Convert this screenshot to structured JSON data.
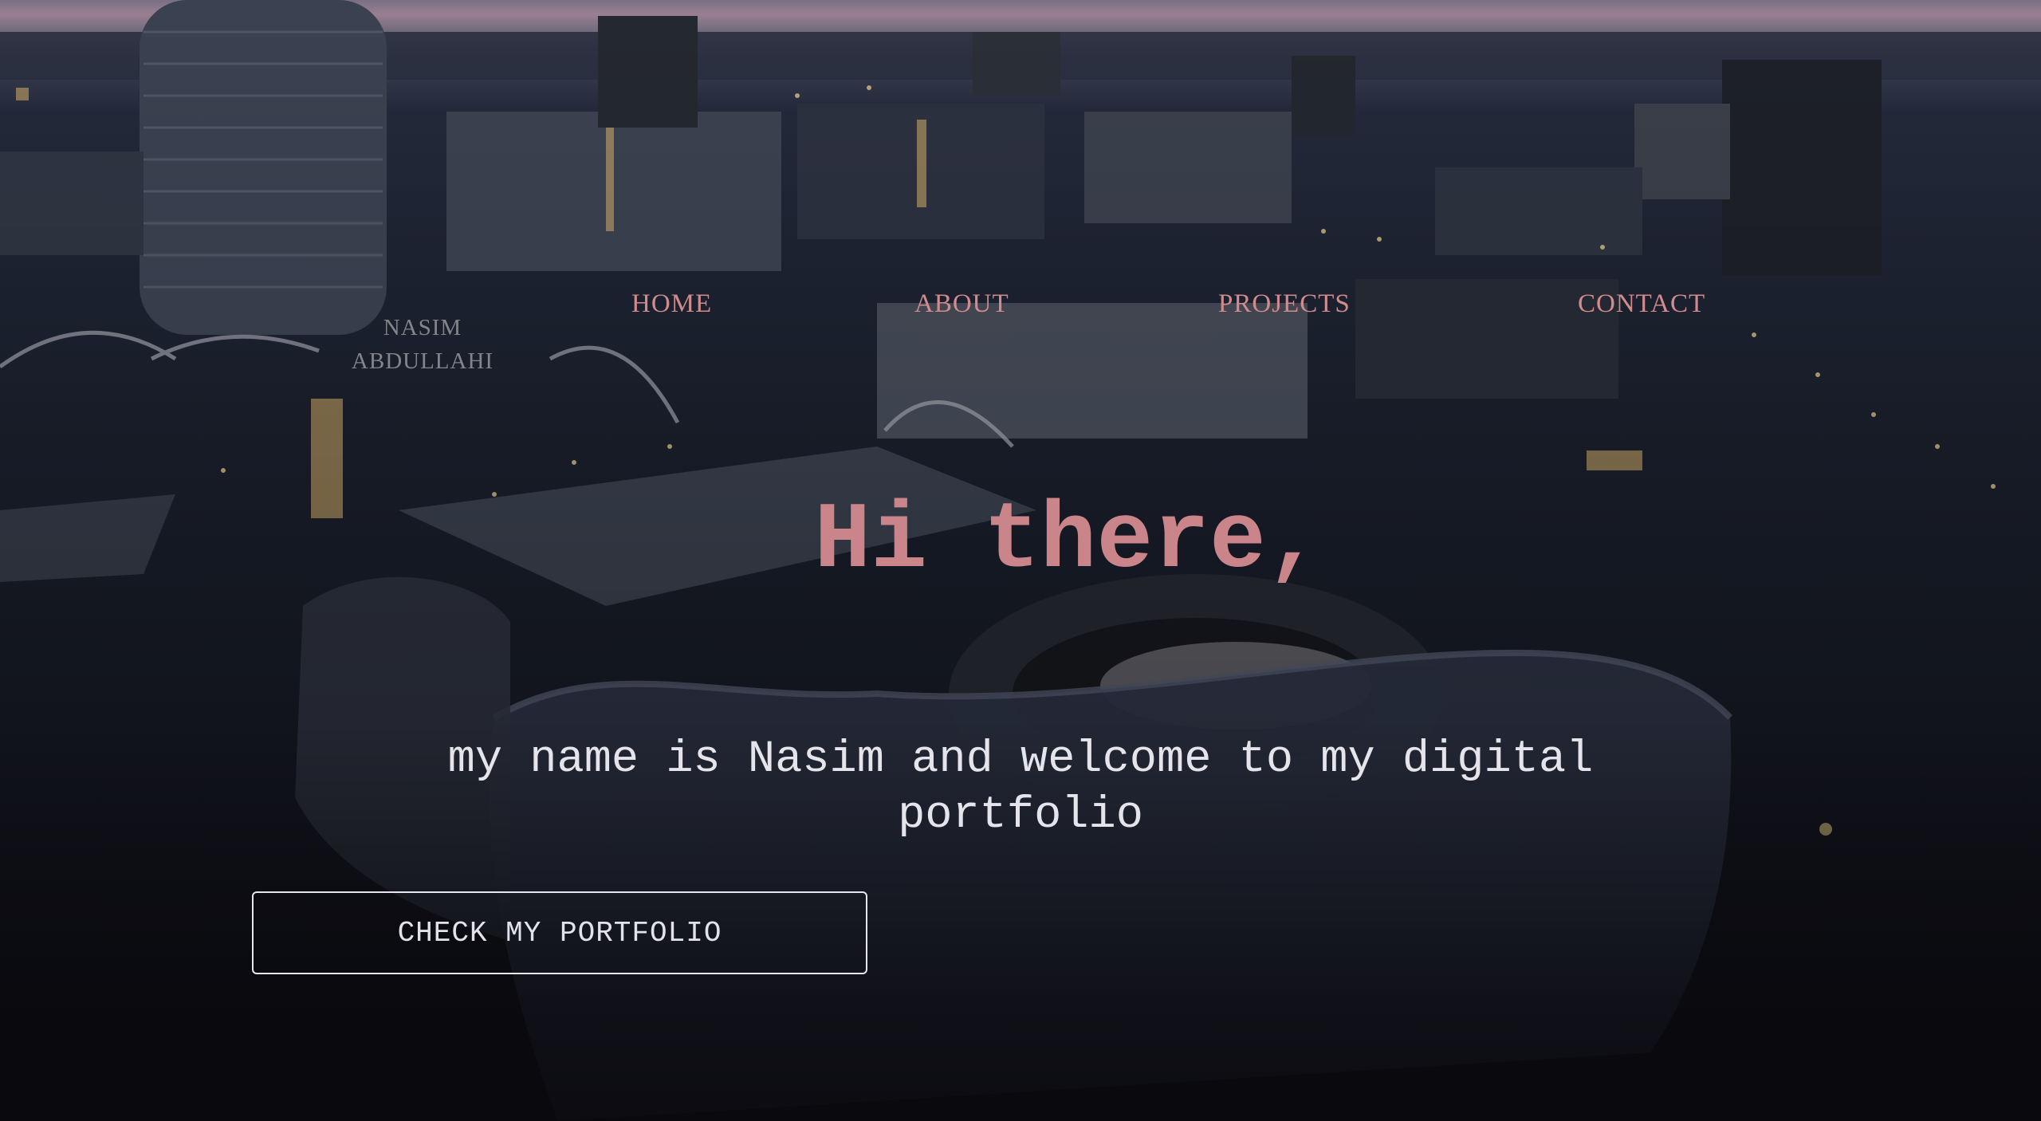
{
  "brand": {
    "name": "NASIM ABDULLAHI"
  },
  "nav": {
    "items": [
      {
        "label": "HOME"
      },
      {
        "label": "ABOUT"
      },
      {
        "label": "PROJECTS"
      },
      {
        "label": "CONTACT"
      }
    ]
  },
  "hero": {
    "headline": "Hi there,",
    "tagline": "my name is Nasim and welcome to my digital portfolio",
    "cta_label": "CHECK MY PORTFOLIO"
  },
  "theme": {
    "accent": "#c98589",
    "nav_color": "#d18b8d",
    "text_light": "#e4e4ea",
    "background": "#12141c"
  },
  "background": {
    "description_icon": "city-skyline-image"
  }
}
